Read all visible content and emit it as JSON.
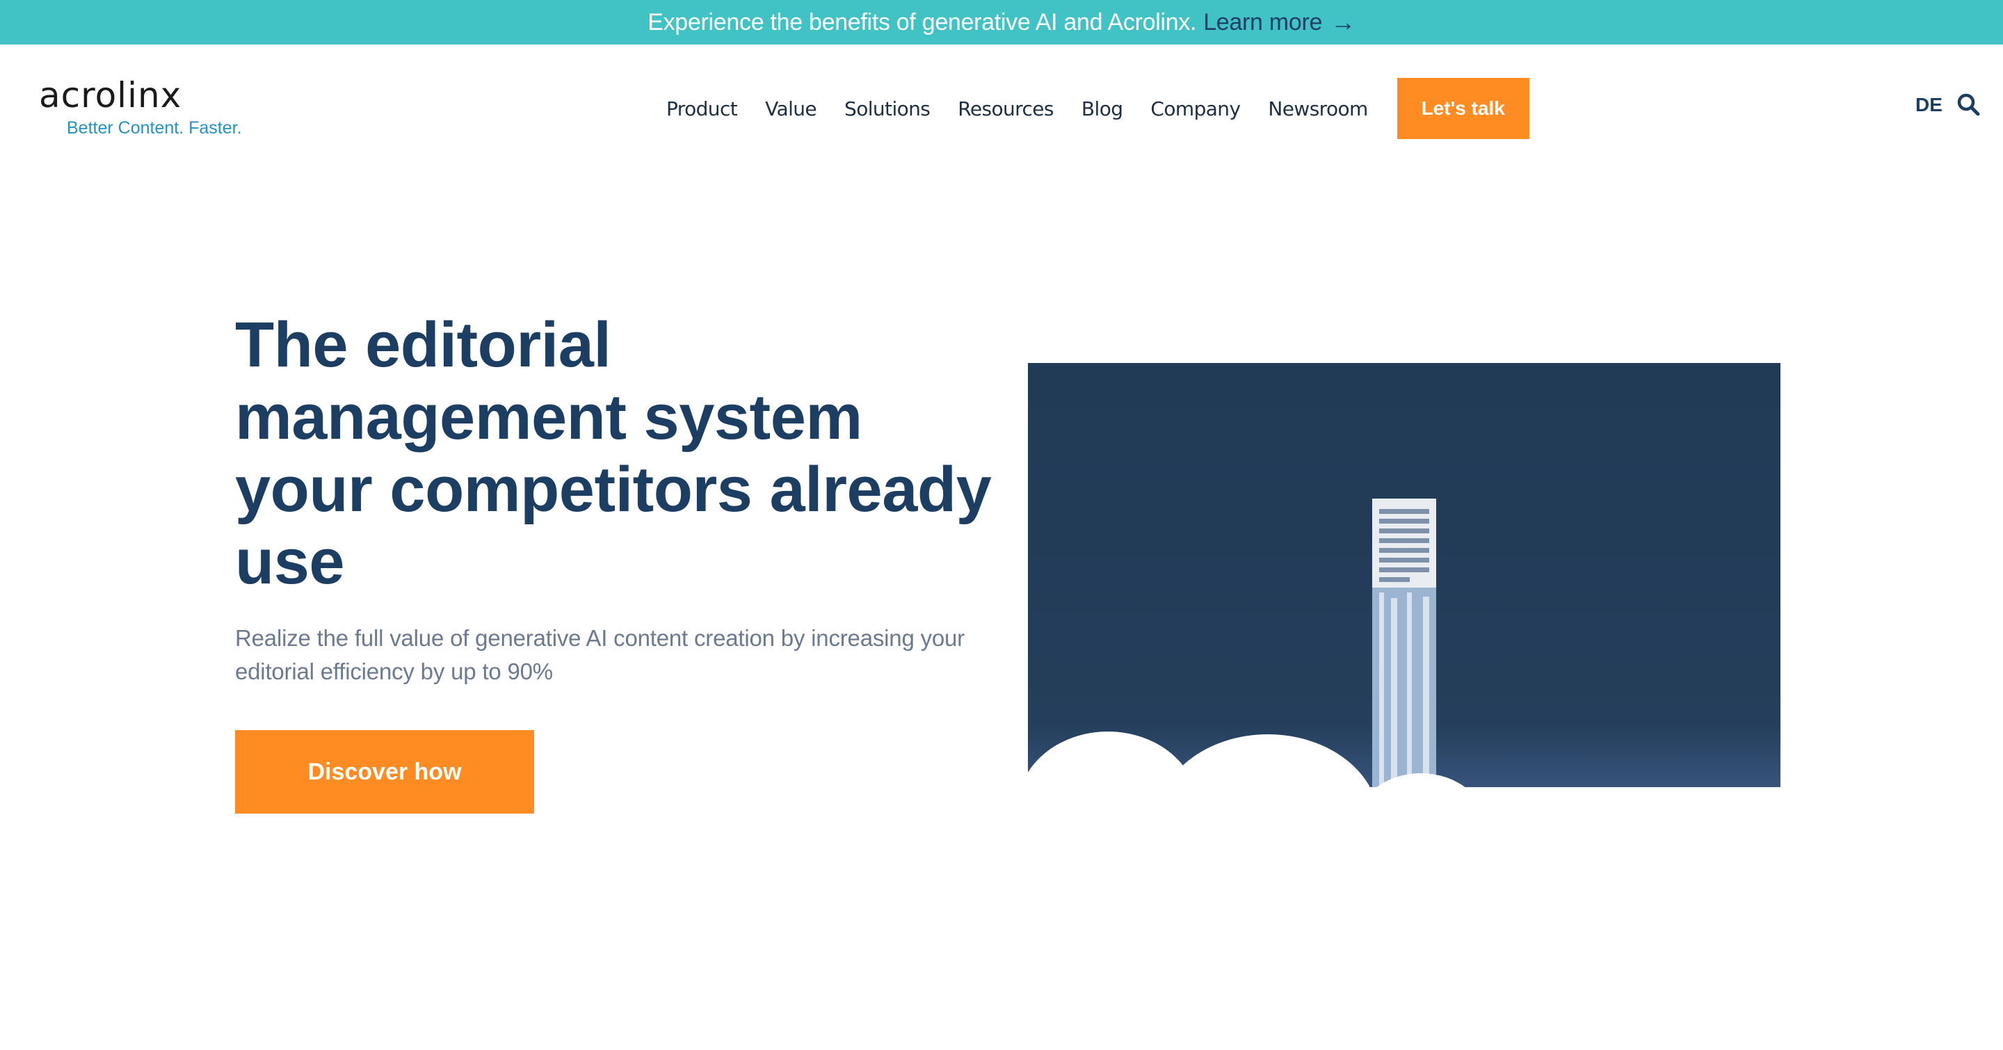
{
  "announcement": {
    "text": "Experience the benefits of generative AI and Acrolinx.",
    "link_label": "Learn more",
    "arrow_icon": "arrow-right-icon"
  },
  "header": {
    "logo": {
      "wordmark": "acrolinx",
      "tagline": "Better Content. Faster."
    },
    "nav": [
      "Product",
      "Value",
      "Solutions",
      "Resources",
      "Blog",
      "Company",
      "Newsroom"
    ],
    "cta_label": "Let's talk",
    "language": "DE",
    "search_icon": "search-icon"
  },
  "hero": {
    "title": "The editorial management system your competitors already use",
    "subtitle": "Realize the full value of generative AI content creation by increasing your editorial efficiency by up to 90%",
    "button_label": "Discover how",
    "illustration_icon": "document-rocket-launch-illustration"
  },
  "colors": {
    "banner": "#41c3c5",
    "navy": "#1d3e63",
    "accent_orange": "#ff8b23",
    "illustration_bg": "#213a56",
    "tagline_blue": "#2493c2"
  }
}
